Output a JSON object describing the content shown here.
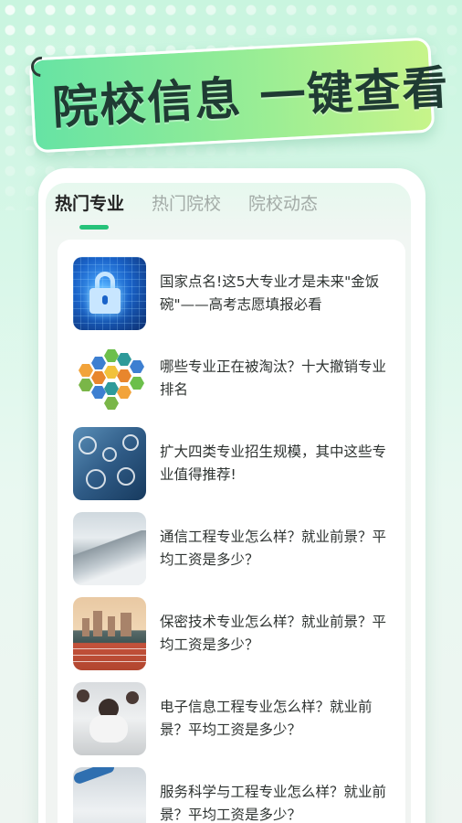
{
  "banner": {
    "title": "院校信息 一键查看"
  },
  "tabs": [
    {
      "label": "热门专业",
      "active": true
    },
    {
      "label": "热门院校",
      "active": false
    },
    {
      "label": "院校动态",
      "active": false
    }
  ],
  "articles": [
    {
      "title": "国家点名!这5大专业才是未来\"金饭碗\"——高考志愿填报必看",
      "thumb": "cyber-lock-image"
    },
    {
      "title": "哪些专业正在被淘汰？十大撤销专业排名",
      "thumb": "hexagon-majors-image"
    },
    {
      "title": "扩大四类专业招生规模，其中这些专业值得推荐!",
      "thumb": "tech-icons-image"
    },
    {
      "title": "通信工程专业怎么样？就业前景？平均工资是多少？",
      "thumb": "mountain-landscape-image"
    },
    {
      "title": "保密技术专业怎么样？就业前景？平均工资是多少？",
      "thumb": "stadium-track-image"
    },
    {
      "title": "电子信息工程专业怎么样？就业前景？平均工资是多少？",
      "thumb": "students-exam-image"
    },
    {
      "title": "服务科学与工程专业怎么样？就业前景？平均工资是多少？",
      "thumb": "desk-writing-image"
    }
  ],
  "colors": {
    "accent": "#26c27a",
    "banner_start": "#66e3a4",
    "banner_end": "#c7f48a",
    "text_dark": "#2e3331",
    "tab_inactive": "#a3aba7"
  }
}
